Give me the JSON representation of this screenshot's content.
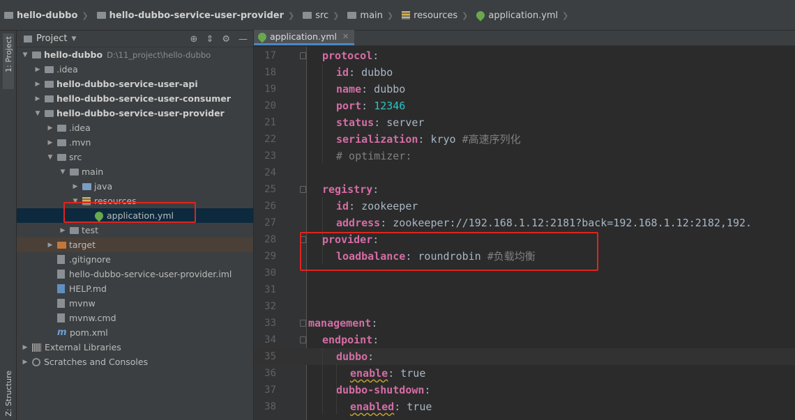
{
  "breadcrumbs": [
    {
      "label": "hello-dubbo",
      "icon": "folder-icon",
      "bold": true
    },
    {
      "label": "hello-dubbo-service-user-provider",
      "icon": "folder-icon",
      "bold": true
    },
    {
      "label": "src",
      "icon": "folder-icon",
      "bold": false
    },
    {
      "label": "main",
      "icon": "folder-icon",
      "bold": false
    },
    {
      "label": "resources",
      "icon": "resources-folder-icon",
      "bold": false
    },
    {
      "label": "application.yml",
      "icon": "spring-leaf-icon",
      "bold": false
    }
  ],
  "side_stripe": {
    "project_label": "1: Project",
    "structure_label": "Z: Structure"
  },
  "panel": {
    "title": "Project"
  },
  "tree": [
    {
      "label": "hello-dubbo",
      "extra": "D:\\11_project\\hello-dubbo",
      "level": 0,
      "twisty": "open",
      "icon": "module-folder-icon",
      "bold": true
    },
    {
      "label": ".idea",
      "level": 1,
      "twisty": "closed",
      "icon": "folder-icon"
    },
    {
      "label": "hello-dubbo-service-user-api",
      "level": 1,
      "twisty": "closed",
      "icon": "module-folder-icon",
      "bold": true
    },
    {
      "label": "hello-dubbo-service-user-consumer",
      "level": 1,
      "twisty": "closed",
      "icon": "module-folder-icon",
      "bold": true
    },
    {
      "label": "hello-dubbo-service-user-provider",
      "level": 1,
      "twisty": "open",
      "icon": "module-folder-icon",
      "bold": true
    },
    {
      "label": ".idea",
      "level": 2,
      "twisty": "closed",
      "icon": "folder-icon"
    },
    {
      "label": ".mvn",
      "level": 2,
      "twisty": "closed",
      "icon": "folder-icon"
    },
    {
      "label": "src",
      "level": 2,
      "twisty": "open",
      "icon": "folder-icon"
    },
    {
      "label": "main",
      "level": 3,
      "twisty": "open",
      "icon": "folder-icon"
    },
    {
      "label": "java",
      "level": 4,
      "twisty": "closed",
      "icon": "source-folder-icon"
    },
    {
      "label": "resources",
      "level": 4,
      "twisty": "open",
      "icon": "resources-folder-icon"
    },
    {
      "label": "application.yml",
      "level": 5,
      "twisty": "",
      "icon": "spring-leaf-icon",
      "selected": true
    },
    {
      "label": "test",
      "level": 3,
      "twisty": "closed",
      "icon": "folder-icon"
    },
    {
      "label": "target",
      "level": 2,
      "twisty": "closed",
      "icon": "excluded-folder-icon",
      "target": true
    },
    {
      "label": ".gitignore",
      "level": 2,
      "twisty": "",
      "icon": "file-icon"
    },
    {
      "label": "hello-dubbo-service-user-provider.iml",
      "level": 2,
      "twisty": "",
      "icon": "iml-file-icon"
    },
    {
      "label": "HELP.md",
      "level": 2,
      "twisty": "",
      "icon": "markdown-file-icon"
    },
    {
      "label": "mvnw",
      "level": 2,
      "twisty": "",
      "icon": "file-icon"
    },
    {
      "label": "mvnw.cmd",
      "level": 2,
      "twisty": "",
      "icon": "file-icon"
    },
    {
      "label": "pom.xml",
      "level": 2,
      "twisty": "",
      "icon": "maven-icon"
    },
    {
      "label": "External Libraries",
      "level": 0,
      "twisty": "closed",
      "icon": "library-icon"
    },
    {
      "label": "Scratches and Consoles",
      "level": 0,
      "twisty": "closed",
      "icon": "scratches-icon"
    }
  ],
  "editor": {
    "tab_label": "application.yml",
    "lines": [
      {
        "n": "17",
        "indent": 1,
        "tokens": [
          [
            "key",
            "protocol"
          ],
          [
            "v",
            ":"
          ]
        ]
      },
      {
        "n": "18",
        "indent": 2,
        "tokens": [
          [
            "key",
            "id"
          ],
          [
            "v",
            ": dubbo"
          ]
        ]
      },
      {
        "n": "19",
        "indent": 2,
        "tokens": [
          [
            "key",
            "name"
          ],
          [
            "v",
            ": dubbo"
          ]
        ]
      },
      {
        "n": "20",
        "indent": 2,
        "tokens": [
          [
            "key",
            "port"
          ],
          [
            "v",
            ": "
          ],
          [
            "num",
            "12346"
          ]
        ]
      },
      {
        "n": "21",
        "indent": 2,
        "tokens": [
          [
            "key",
            "status"
          ],
          [
            "v",
            ": server"
          ]
        ]
      },
      {
        "n": "22",
        "indent": 2,
        "tokens": [
          [
            "key",
            "serialization"
          ],
          [
            "v",
            ": kryo "
          ],
          [
            "cm",
            "#高速序列化"
          ]
        ]
      },
      {
        "n": "23",
        "indent": 2,
        "tokens": [
          [
            "cm",
            "# optimizer:"
          ]
        ]
      },
      {
        "n": "24",
        "indent": 0,
        "tokens": []
      },
      {
        "n": "25",
        "indent": 1,
        "tokens": [
          [
            "key",
            "registry"
          ],
          [
            "v",
            ":"
          ]
        ]
      },
      {
        "n": "26",
        "indent": 2,
        "tokens": [
          [
            "key",
            "id"
          ],
          [
            "v",
            ": zookeeper"
          ]
        ]
      },
      {
        "n": "27",
        "indent": 2,
        "tokens": [
          [
            "key",
            "address"
          ],
          [
            "v",
            ": zookeeper://192.168.1.12:2181?back=192.168.1.12:2182,192."
          ]
        ]
      },
      {
        "n": "28",
        "indent": 1,
        "tokens": [
          [
            "key",
            "provider"
          ],
          [
            "v",
            ":"
          ]
        ]
      },
      {
        "n": "29",
        "indent": 2,
        "tokens": [
          [
            "key",
            "loadbalance"
          ],
          [
            "v",
            ": roundrobin "
          ],
          [
            "cm",
            "#负载均衡"
          ]
        ]
      },
      {
        "n": "30",
        "indent": 0,
        "tokens": []
      },
      {
        "n": "31",
        "indent": 0,
        "tokens": []
      },
      {
        "n": "32",
        "indent": 0,
        "tokens": []
      },
      {
        "n": "33",
        "indent": 0,
        "tokens": [
          [
            "key",
            "management"
          ],
          [
            "v",
            ":"
          ]
        ]
      },
      {
        "n": "34",
        "indent": 1,
        "tokens": [
          [
            "key",
            "endpoint"
          ],
          [
            "v",
            ":"
          ]
        ]
      },
      {
        "n": "35",
        "indent": 2,
        "tokens": [
          [
            "key",
            "dubbo"
          ],
          [
            "v",
            ":"
          ]
        ],
        "highlight": true
      },
      {
        "n": "36",
        "indent": 3,
        "tokens": [
          [
            "keyw",
            "enable"
          ],
          [
            "v",
            ": true"
          ]
        ]
      },
      {
        "n": "37",
        "indent": 2,
        "tokens": [
          [
            "key",
            "dubbo-shutdown"
          ],
          [
            "v",
            ":"
          ]
        ]
      },
      {
        "n": "38",
        "indent": 3,
        "tokens": [
          [
            "keyw",
            "enabled"
          ],
          [
            "v",
            ": true"
          ]
        ]
      }
    ]
  },
  "colors": {
    "highlight_box": "#e0241d",
    "key": "#d56da5",
    "number": "#2ac6c6",
    "comment": "#808080",
    "selection": "#0d293e"
  }
}
